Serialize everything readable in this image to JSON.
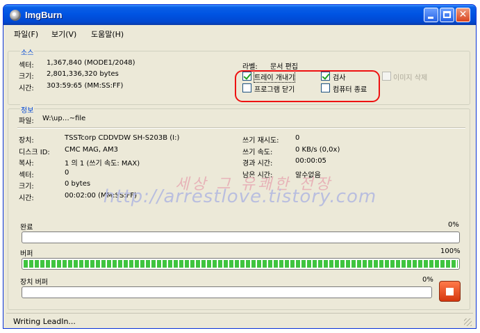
{
  "window": {
    "title": "ImgBurn"
  },
  "menu": {
    "file": "파일(F)",
    "view": "보기(V)",
    "help": "도움말(H)"
  },
  "source": {
    "label": "소스",
    "sectors_label": "섹터:",
    "sectors_value": "1,367,840 (MODE1/2048)",
    "size_label": "크기:",
    "size_value": "2,801,336,320 bytes",
    "time_label": "시간:",
    "time_value": "303:59:65 (MM:SS:FF)",
    "volume_label": "라벨:",
    "volume_value": "문서 편집",
    "opt_eject": "트레이 개내기",
    "opt_verify": "검사",
    "opt_delete_image": "이미지 삭제",
    "opt_close_program": "프로그램 닫기",
    "opt_shutdown": "컴퓨터 종료"
  },
  "info": {
    "label": "정보",
    "file_label": "파일:",
    "file_value": "W:\\up…~file",
    "device_label": "장치:",
    "device_value": "TSSTcorp CDDVDW SH-S203B (I:)",
    "disc_id_label": "디스크 ID:",
    "disc_id_value": "CMC MAG, AM3",
    "copies_label": "복사:",
    "copies_value": "1 의 1 (쓰기 속도: MAX)",
    "sectors_label": "섹터:",
    "sectors_value": "0",
    "size_label": "크기:",
    "size_value": "0 bytes",
    "time_label": "시간:",
    "time_value": "00:02:00 (MM:SS:FF)",
    "retries_label": "쓰기 재시도:",
    "retries_value": "0",
    "speed_label": "쓰기 속도:",
    "speed_value": "0 KB/s (0,0x)",
    "elapsed_label": "경과 시간:",
    "elapsed_value": "00:00:05",
    "remaining_label": "남은 시간:",
    "remaining_value": "알수없음"
  },
  "progress": {
    "complete_label": "완료",
    "complete_pct": "0%",
    "complete_fraction": 0,
    "buffer_label": "버퍼",
    "buffer_pct": "100%",
    "buffer_fraction": 1,
    "device_buffer_label": "장치 버퍼",
    "device_buffer_pct": "0%",
    "device_buffer_fraction": 0
  },
  "status": {
    "text": "Writing LeadIn..."
  },
  "watermark": {
    "line1": "세상 그 유쾌한 전장",
    "line2": "http://arrestlove.tistory.com"
  },
  "colors": {
    "title_bar": "#0054e3",
    "accent_label": "#0046d5",
    "progress_fill": "#3fc43f",
    "stop_button": "#d5370f",
    "highlight_ring": "#ee1111"
  },
  "icons": {
    "app": "disc-icon",
    "stop": "stop-icon",
    "check": "checkmark-icon"
  }
}
